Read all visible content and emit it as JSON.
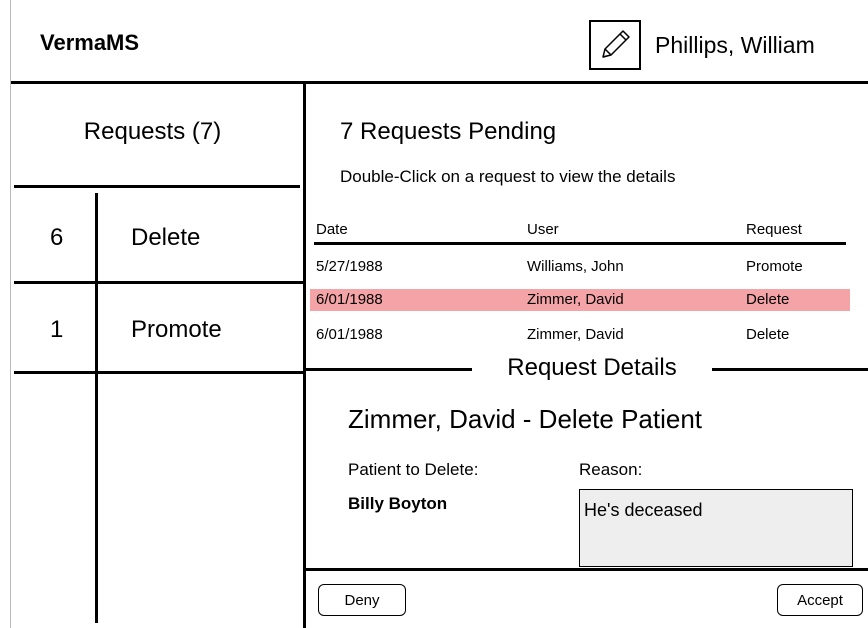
{
  "header": {
    "app_name": "VermaMS",
    "edit_icon": "pencil-icon",
    "user_name": "Phillips, William"
  },
  "sidebar": {
    "heading": "Requests (7)",
    "items": [
      {
        "count": "6",
        "label": "Delete"
      },
      {
        "count": "1",
        "label": "Promote"
      }
    ]
  },
  "main": {
    "title": "7 Requests Pending",
    "subtitle": "Double-Click on a request to view the details",
    "columns": [
      "Date",
      "User",
      "Request"
    ],
    "rows": [
      {
        "date": "5/27/1988",
        "user": "Williams, John",
        "request": "Promote",
        "selected": false
      },
      {
        "date": "6/01/1988",
        "user": "Zimmer, David",
        "request": "Delete",
        "selected": true
      },
      {
        "date": "6/01/1988",
        "user": "Zimmer, David",
        "request": "Delete",
        "selected": false
      }
    ],
    "highlight_color": "#f4a3a6"
  },
  "details": {
    "section_label": "Request Details",
    "title": "Zimmer, David - Delete Patient",
    "patient_label": "Patient to Delete:",
    "patient_name": "Billy Boyton",
    "reason_label": "Reason:",
    "reason_text": "He's deceased"
  },
  "actions": {
    "deny": "Deny",
    "accept": "Accept"
  }
}
